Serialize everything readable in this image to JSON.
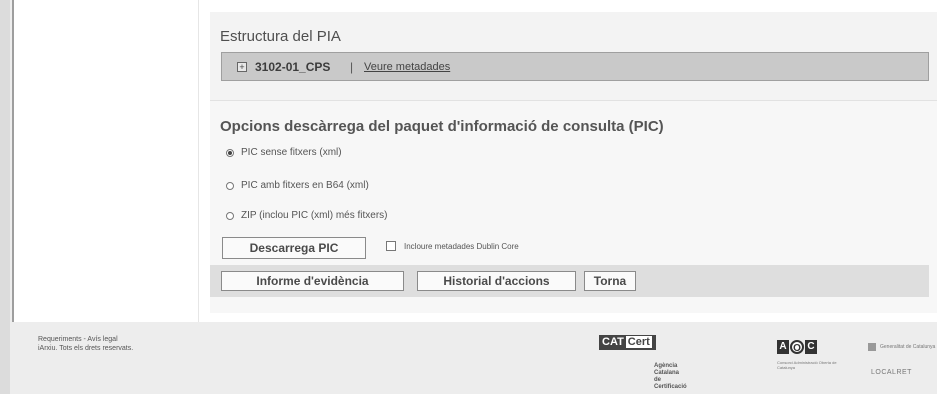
{
  "structure": {
    "title": "Estructura del PIA",
    "node_toggle": "+",
    "node_label": "3102-01_CPS",
    "separator": "|",
    "metadata_link": "Veure metadades"
  },
  "download": {
    "title": "Opcions descàrrega del paquet d'informació de consulta (PIC)",
    "options": [
      {
        "label": "PIC sense fitxers (xml)",
        "selected": true
      },
      {
        "label": "PIC amb fitxers en B64 (xml)",
        "selected": false
      },
      {
        "label": "ZIP (inclou PIC (xml) més fitxers)",
        "selected": false
      }
    ],
    "download_button": "Descarrega PIC",
    "dublin_core_label": "Incloure metadades Dublin Core"
  },
  "actions": {
    "evidence": "Informe d'evidència",
    "history": "Historial d'accions",
    "back": "Torna"
  },
  "footer": {
    "links": "Requeriments - Avís legal",
    "copyright": "iArxiu. Tots els drets reservats.",
    "catcert_a": "CAT",
    "catcert_b": "Cert",
    "catcert_sub1": "Agència Catalana",
    "catcert_sub2": "de Certificació",
    "aoc_a": "A",
    "aoc_b": "O",
    "aoc_c": "C",
    "aoc_sub": "Consorci Administració Oberta de Catalunya",
    "gencat": "Generalitat de Catalunya",
    "localret": "LOCALRET"
  }
}
